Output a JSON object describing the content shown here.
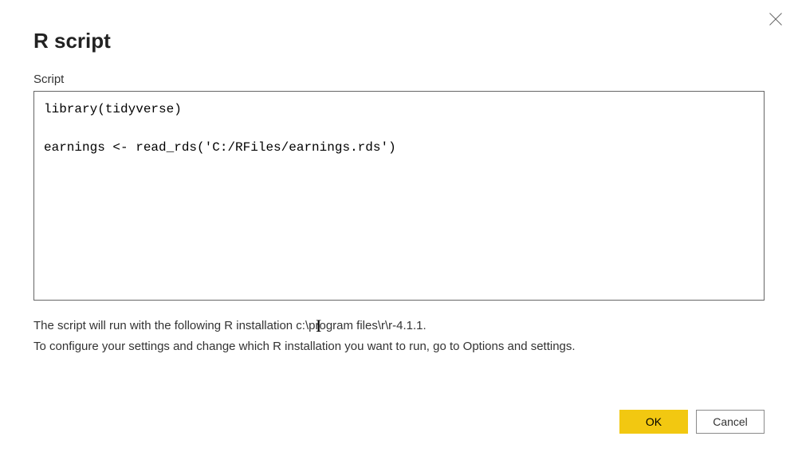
{
  "dialog": {
    "title": "R script",
    "script_label": "Script",
    "script_content": "library(tidyverse)\n\nearnings <- read_rds('C:/RFiles/earnings.rds')",
    "info_line1": "The script will run with the following R installation c:\\program files\\r\\r-4.1.1.",
    "info_line2": "To configure your settings and change which R installation you want to run, go to Options and settings.",
    "buttons": {
      "ok": "OK",
      "cancel": "Cancel"
    }
  },
  "colors": {
    "accent": "#f2c811"
  }
}
